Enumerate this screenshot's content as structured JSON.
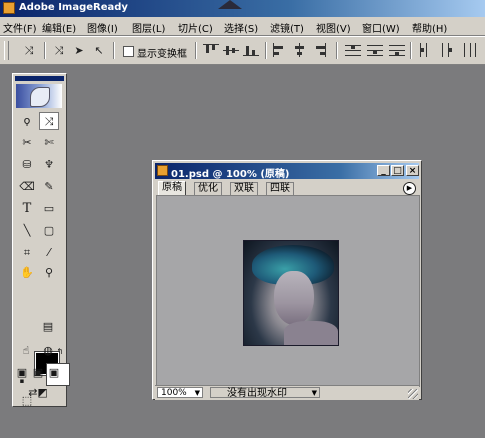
{
  "app": {
    "title": "Adobe ImageReady"
  },
  "menu": [
    "文件(F)",
    "编辑(E)",
    "图像(I)",
    "图层(L)",
    "切片(C)",
    "选择(S)",
    "滤镜(T)",
    "视图(V)",
    "窗口(W)",
    "帮助(H)"
  ],
  "options": {
    "show_transform_label": "显示变换框",
    "show_transform_checked": false
  },
  "toolbox": {
    "icons": [
      "logo-icon",
      "marquee-icon",
      "move-icon",
      "lasso-icon",
      "magic-wand-icon",
      "slice-icon",
      "slice-select-icon",
      "brush-icon",
      "clone-stamp-icon",
      "eraser-icon",
      "paint-bucket-icon",
      "type-icon",
      "rectangle-icon",
      "line-icon",
      "shape-icon",
      "crop-icon",
      "eyedropper-icon",
      "hand-icon",
      "zoom-icon",
      "foreground-color",
      "background-color",
      "image-map-icon",
      "preview-icon",
      "rollover-icon",
      "browser-icon",
      "screen-mode-icon",
      "jump-to-photoshop-icon"
    ],
    "foreground_color": "#000000",
    "background_color": "#ffffff"
  },
  "document": {
    "title": "01.psd @ 100% (原稿)",
    "tabs": [
      "原稿",
      "优化",
      "双联",
      "四联"
    ],
    "active_tab": "原稿",
    "zoom": "100%",
    "watermark_status": "没有出现水印",
    "window_buttons": [
      "minimize-icon",
      "maximize-icon",
      "close-icon"
    ]
  },
  "colors": {
    "title_bar": "#0a246a",
    "workspace": "#7b7b7d",
    "canvas": "#a6a6a8",
    "chrome": "#d4d0c8"
  }
}
